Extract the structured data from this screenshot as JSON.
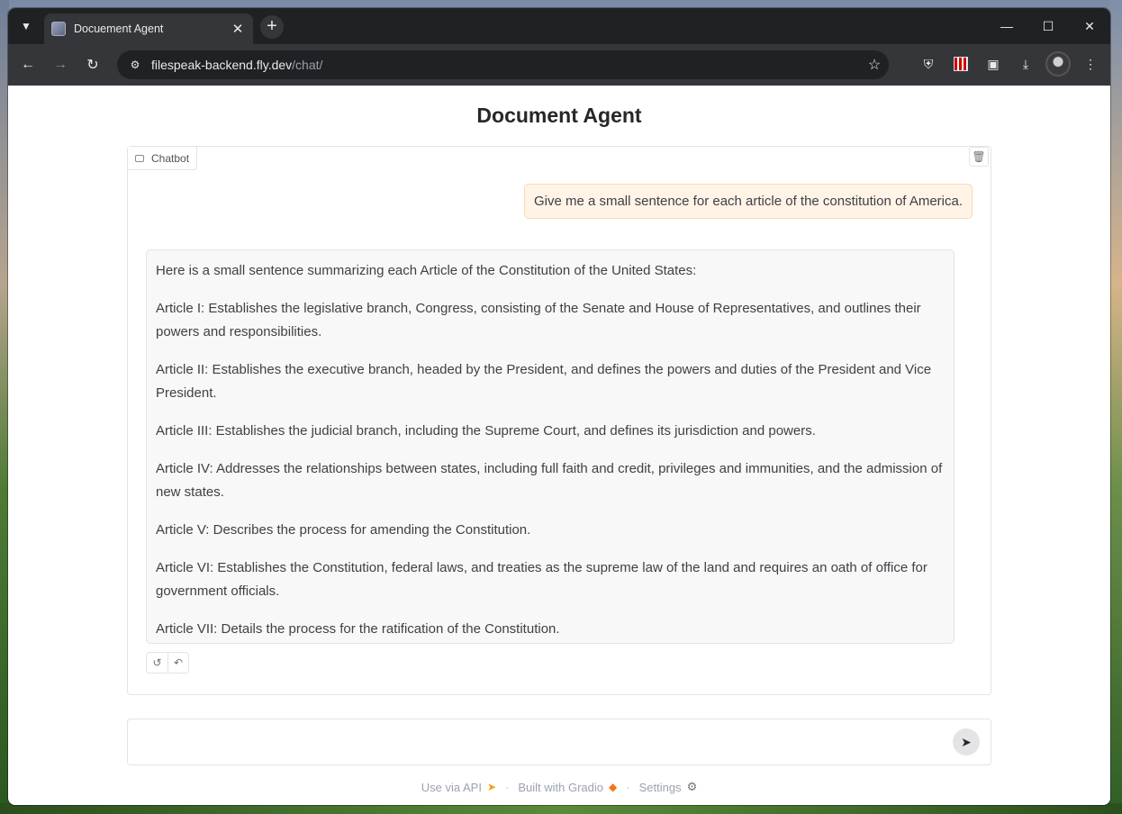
{
  "browser": {
    "tab_title": "Docuement Agent",
    "url_host": "filespeak-backend.fly.dev",
    "url_path": "/chat/",
    "icons": {
      "tab_search": "chevron-down-icon",
      "close_tab": "close-icon",
      "new_tab": "plus-icon",
      "back": "arrow-left-icon",
      "forward": "arrow-right-icon",
      "reload": "reload-icon",
      "bookmark": "star-icon",
      "download": "download-icon"
    }
  },
  "app": {
    "title": "Document Agent",
    "chatbot_label": "Chatbot",
    "messages": {
      "user": "Give me a small sentence for each article of the constitution of America.",
      "bot": [
        "Here is a small sentence summarizing each Article of the Constitution of the United States:",
        "Article I: Establishes the legislative branch, Congress, consisting of the Senate and House of Representatives, and outlines their powers and responsibilities.",
        "Article II: Establishes the executive branch, headed by the President, and defines the powers and duties of the President and Vice President.",
        "Article III: Establishes the judicial branch, including the Supreme Court, and defines its jurisdiction and powers.",
        "Article IV: Addresses the relationships between states, including full faith and credit, privileges and immunities, and the admission of new states.",
        "Article V: Describes the process for amending the Constitution.",
        "Article VI: Establishes the Constitution, federal laws, and treaties as the supreme law of the land and requires an oath of office for government officials.",
        "Article VII: Details the process for the ratification of the Constitution."
      ]
    },
    "input": {
      "value": "",
      "placeholder": ""
    },
    "footer": {
      "api": "Use via API",
      "built": "Built with Gradio",
      "settings": "Settings",
      "separator": "·"
    }
  }
}
